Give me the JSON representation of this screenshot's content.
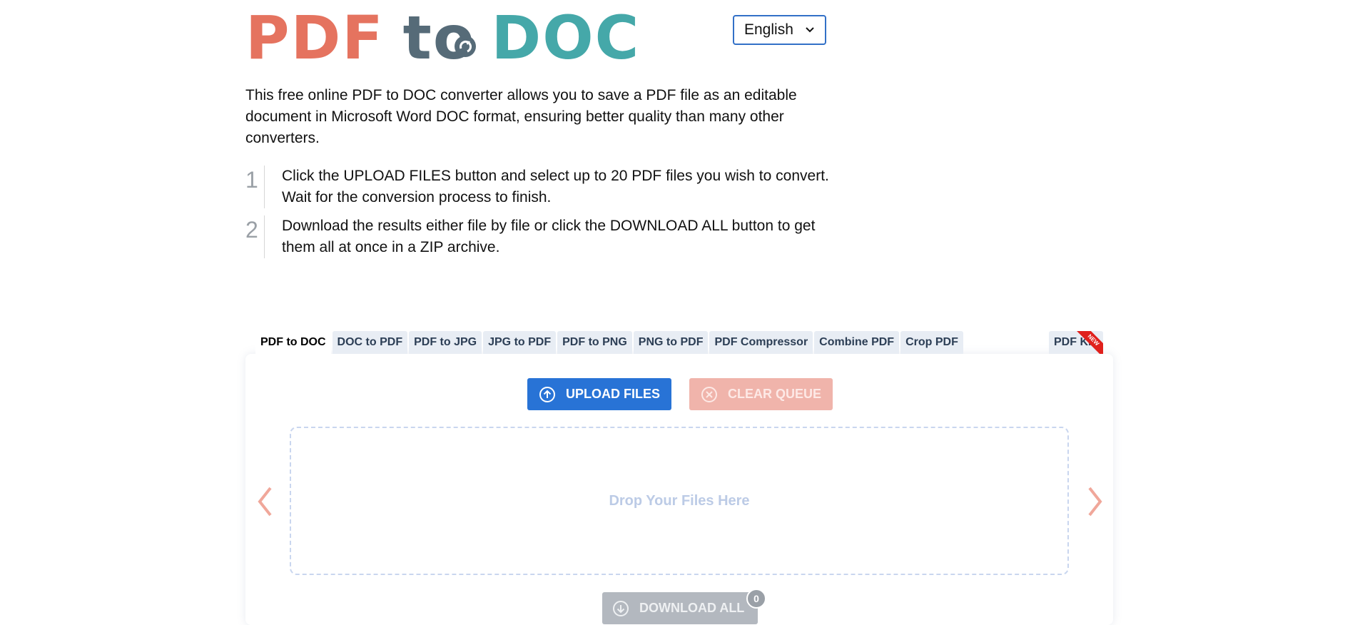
{
  "logo": {
    "part1": "PDF",
    "part2": "to",
    "part3": "DOC"
  },
  "language": {
    "selected": "English"
  },
  "intro": "This free online PDF to DOC converter allows you to save a PDF file as an editable document in Microsoft Word DOC format, ensuring better quality than many other converters.",
  "steps": [
    {
      "num": "1",
      "text": "Click the UPLOAD FILES button and select up to 20 PDF files you wish to convert. Wait for the conversion process to finish."
    },
    {
      "num": "2",
      "text": "Download the results either file by file or click the DOWNLOAD ALL button to get them all at once in a ZIP archive."
    }
  ],
  "tabs": [
    "PDF to DOC",
    "DOC to PDF",
    "PDF to JPG",
    "JPG to PDF",
    "PDF to PNG",
    "PNG to PDF",
    "PDF Compressor",
    "Combine PDF",
    "Crop PDF"
  ],
  "tab_kit": {
    "label": "PDF Kit",
    "badge": "NEW"
  },
  "buttons": {
    "upload": "UPLOAD FILES",
    "clear": "CLEAR QUEUE",
    "download_all": "DOWNLOAD ALL"
  },
  "dropzone": {
    "label": "Drop Your Files Here"
  },
  "queue_count": "0",
  "colors": {
    "logo_pdf": "#e5735f",
    "logo_to": "#566b78",
    "logo_doc": "#45a8a9",
    "upload": "#2873d6",
    "clear": "#f0b4ab",
    "download": "#b3b8bf",
    "arrow": "#f0a79a"
  },
  "icons": {
    "upload": "upload-arrow-circle-icon",
    "clear": "x-circle-icon",
    "download": "download-arrow-circle-icon",
    "prev": "chevron-left-icon",
    "next": "chevron-right-icon",
    "language": "chevron-down-icon"
  }
}
